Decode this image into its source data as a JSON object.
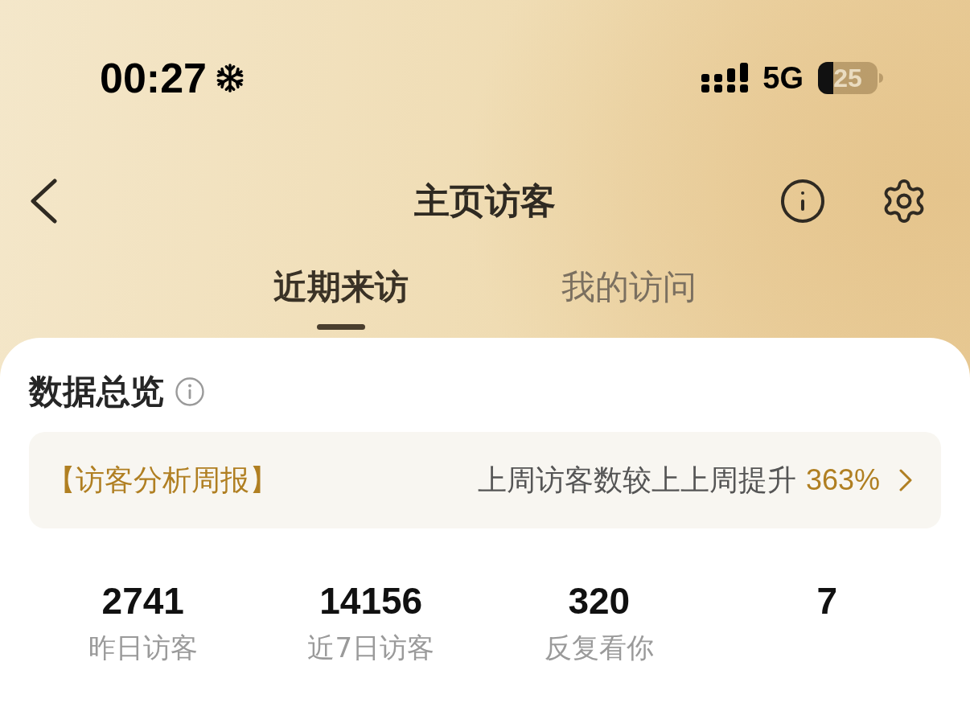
{
  "status_bar": {
    "time": "00:27",
    "network": "5G",
    "battery": {
      "text": "25",
      "level": 0.25
    }
  },
  "nav": {
    "title": "主页访客"
  },
  "tabs": [
    {
      "label": "近期来访",
      "selected": true
    },
    {
      "label": "我的访问",
      "selected": false
    }
  ],
  "overview": {
    "title": "数据总览",
    "banner": {
      "tag": "【访客分析周报】",
      "text": "上周访客数较上上周提升",
      "highlight": "363%"
    },
    "stats": [
      {
        "value": "2741",
        "label": "昨日访客"
      },
      {
        "value": "14156",
        "label": "近7日访客"
      },
      {
        "value": "320",
        "label": "反复看你"
      },
      {
        "value": "7"
      }
    ]
  }
}
